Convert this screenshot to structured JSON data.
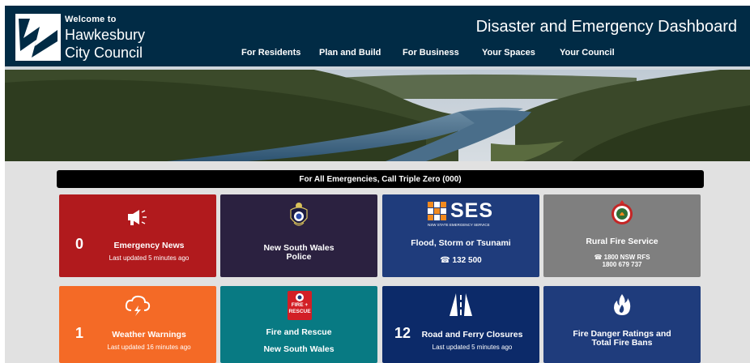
{
  "header": {
    "brand_welcome": "Welcome to",
    "brand_line1": "Hawkesbury",
    "brand_line2": "City Council",
    "dashboard_title": "Disaster and Emergency Dashboard",
    "nav": [
      "For Residents",
      "Plan and Build",
      "For Business",
      "Your Spaces",
      "Your Council"
    ]
  },
  "banner": {
    "text": "For All Emergencies, Call Triple Zero (000)"
  },
  "tiles": [
    {
      "name": "Emergency News",
      "count": "0",
      "sub": "Last updated 5 minutes ago",
      "color": "#b11a1d",
      "icon": "megaphone-icon"
    },
    {
      "name_line1": "New South Wales",
      "name_line2": "Police",
      "color": "#2b2140",
      "icon": "police-badge-icon"
    },
    {
      "name": "Flood, Storm or Tsunami",
      "phone": "132 500",
      "logo_text": "SES",
      "logo_sub": "NSW STATE EMERGENCY SERVICE",
      "color": "#1f3c7c",
      "icon": "phone-icon"
    },
    {
      "name": "Rural Fire Service",
      "phone_line1": "1800 NSW RFS",
      "phone_line2": "1800 679 737",
      "color": "#7f7f7f",
      "icon": "rfs-badge-icon"
    },
    {
      "name": "Weather Warnings",
      "count": "1",
      "sub": "Last updated 16 minutes ago",
      "color": "#f46a26",
      "icon": "storm-cloud-icon"
    },
    {
      "name_line1": "Fire and Rescue",
      "name_line2": "New South Wales",
      "badge_line1": "FIRE +",
      "badge_line2": "RESCUE",
      "color": "#087a83",
      "icon": "fire-rescue-badge-icon"
    },
    {
      "name": "Road and Ferry Closures",
      "count": "12",
      "sub": "Last updated 5 minutes ago",
      "color": "#0c2a69",
      "icon": "road-icon"
    },
    {
      "name_line1": "Fire Danger Ratings and",
      "name_line2": "Total Fire Bans",
      "color": "#1f3c7c",
      "icon": "flame-icon"
    }
  ]
}
